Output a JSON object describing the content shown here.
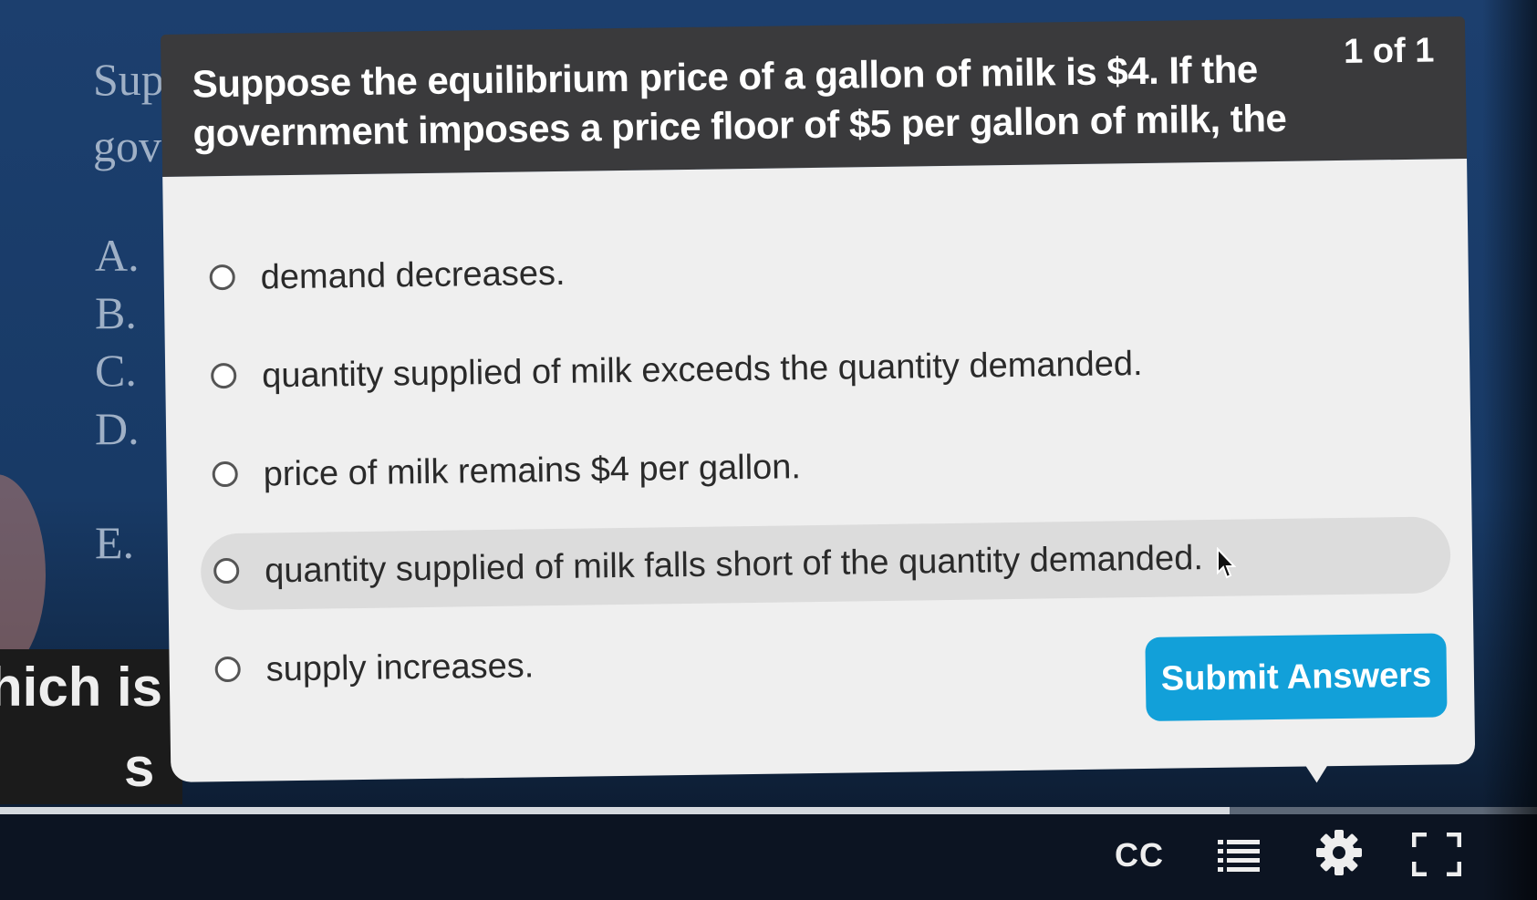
{
  "background_slide": {
    "question_line_1": "Sup",
    "question_line_2": "gov",
    "letters": [
      "A.",
      "B.",
      "C.",
      "D.",
      "E."
    ],
    "caption_line_1": "hich is",
    "caption_line_2": "s"
  },
  "quiz": {
    "question": "Suppose the equilibrium price of a gallon of milk is $4. If the government imposes a price floor of $5 per gallon of milk, the",
    "counter": "1 of 1",
    "options": [
      {
        "label": "demand decreases."
      },
      {
        "label": "quantity supplied of milk exceeds the quantity demanded."
      },
      {
        "label": "price of milk remains $4 per gallon."
      },
      {
        "label": "quantity supplied of milk falls short of the quantity demanded."
      },
      {
        "label": "supply increases."
      }
    ],
    "submit_label": "Submit Answers"
  },
  "player": {
    "progress": 0.8,
    "cc_label": "CC"
  },
  "colors": {
    "header_bg": "#3a3a3c",
    "body_bg": "#efefef",
    "submit_bg": "#12a0d9",
    "hover_option_bg": "#dcdcdc"
  }
}
